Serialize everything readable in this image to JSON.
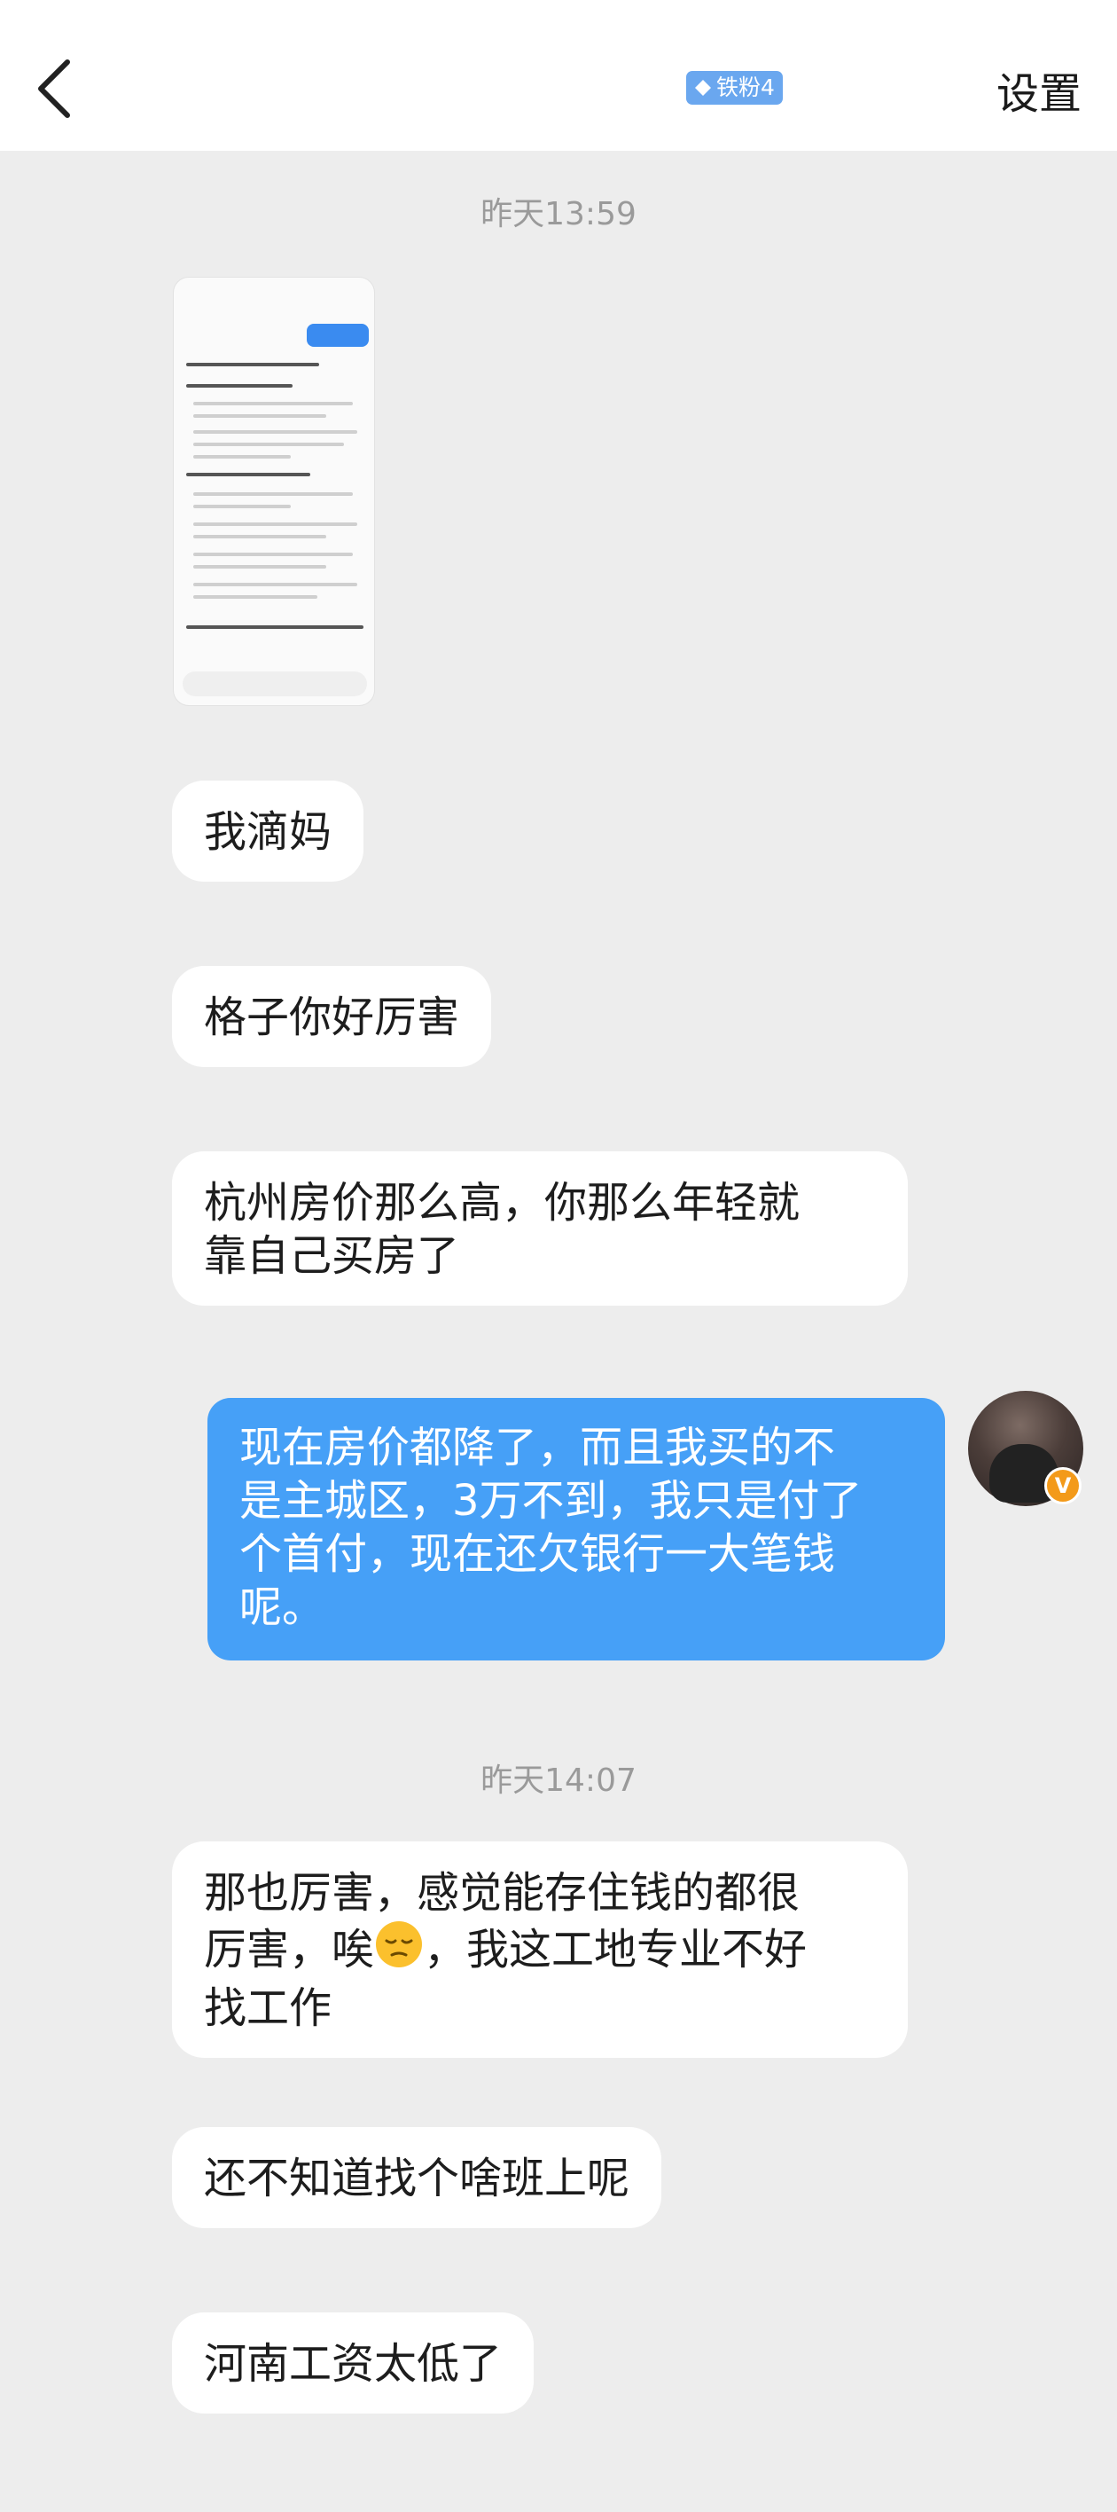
{
  "header": {
    "badge_label": "铁粉4",
    "settings_label": "设置"
  },
  "colors": {
    "outgoing_bubble": "#46a0f7",
    "incoming_bubble": "#ffffff",
    "background": "#ededed",
    "badge": "#6aa7ef",
    "verified_badge": "#f39a1a"
  },
  "messages": {
    "timestamp_1": "昨天13:59",
    "image_message": "screenshot-thumbnail",
    "msg1": "我滴妈",
    "msg2": "格子你好厉害",
    "msg3_line1": "杭州房价那么高，你那么年轻就",
    "msg3_line2": "靠自己买房了",
    "out_line1": "现在房价都降了，而且我买的不",
    "out_line2": "是主城区，3万不到，我只是付了",
    "out_line3": "个首付，现在还欠银行一大笔钱",
    "out_line4": "呢。",
    "timestamp_2": "昨天14:07",
    "msg5_line1": "那也厉害，感觉能存住钱的都很",
    "msg5_line2a": "厉害，唉",
    "msg5_line2b": "，我这工地专业不好",
    "msg5_line3": "找工作",
    "msg6": "还不知道找个啥班上呢",
    "msg7": "河南工资太低了",
    "avatar_badge": "V"
  }
}
